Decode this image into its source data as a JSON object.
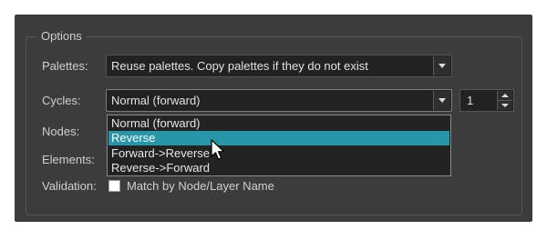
{
  "group_title": "Options",
  "fields": {
    "palettes_label": "Palettes:",
    "palettes_value": "Reuse palettes. Copy palettes if they do not exist",
    "cycles_label": "Cycles:",
    "cycles_value": "Normal (forward)",
    "cycles_count": "1",
    "nodes_label": "Nodes:",
    "elements_label": "Elements:",
    "validation_label": "Validation:",
    "validation_checkbox_label": "Match by Node/Layer Name",
    "validation_checked": false
  },
  "cycles_dropdown": {
    "options": [
      "Normal (forward)",
      "Reverse",
      "Forward->Reverse",
      "Reverse->Forward"
    ],
    "highlighted": "Reverse"
  },
  "colors": {
    "panel_bg": "#3c3c3c",
    "field_bg": "#222222",
    "highlight": "#2796a8"
  }
}
